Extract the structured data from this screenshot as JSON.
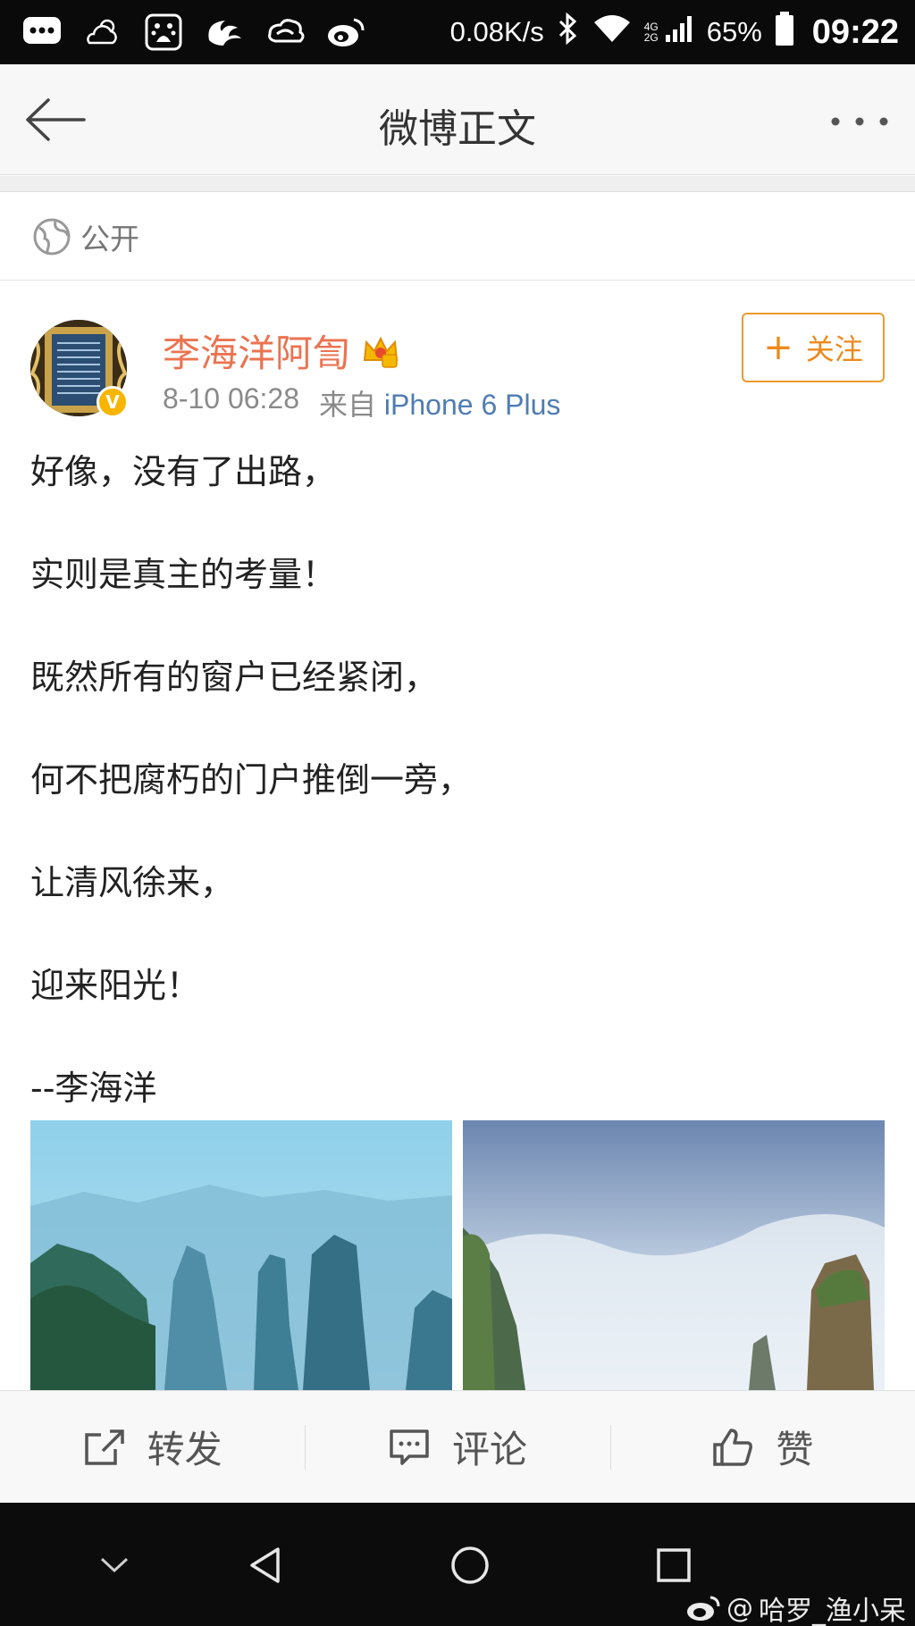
{
  "status_bar": {
    "icons": [
      "message-icon",
      "weather-icon",
      "baidu-icon",
      "uc-browser-icon",
      "cloud-icon",
      "weibo-icon"
    ],
    "net_speed": "0.08K/s",
    "network_top": "4G",
    "network_bottom": "2G",
    "battery": "65%",
    "time": "09:22"
  },
  "header": {
    "title": "微博正文",
    "back_icon": "back-arrow-icon",
    "more_icon": "more-dots-icon"
  },
  "visibility": {
    "icon": "globe-icon",
    "label": "公开"
  },
  "author": {
    "name": "李海洋阿訇",
    "verified_badge": "V",
    "timestamp": "8-10 06:28",
    "source_prefix": "来自",
    "source": "iPhone 6 Plus",
    "follow_label": "关注",
    "follow_plus": "+",
    "accent": "#eb7350",
    "follow_color": "#ec8a1d",
    "link_color": "#4f7db3"
  },
  "post": {
    "lines": [
      "好像，没有了出路，",
      "实则是真主的考量！",
      "既然所有的窗户已经紧闭，",
      "何不把腐朽的门户推倒一旁，",
      "让清风徐来，",
      "迎来阳光！",
      "--李海洋"
    ]
  },
  "actions": {
    "repost": "转发",
    "comment": "评论",
    "like": "赞"
  },
  "watermark": {
    "prefix": "@",
    "text": "哈罗_渔小呆"
  }
}
